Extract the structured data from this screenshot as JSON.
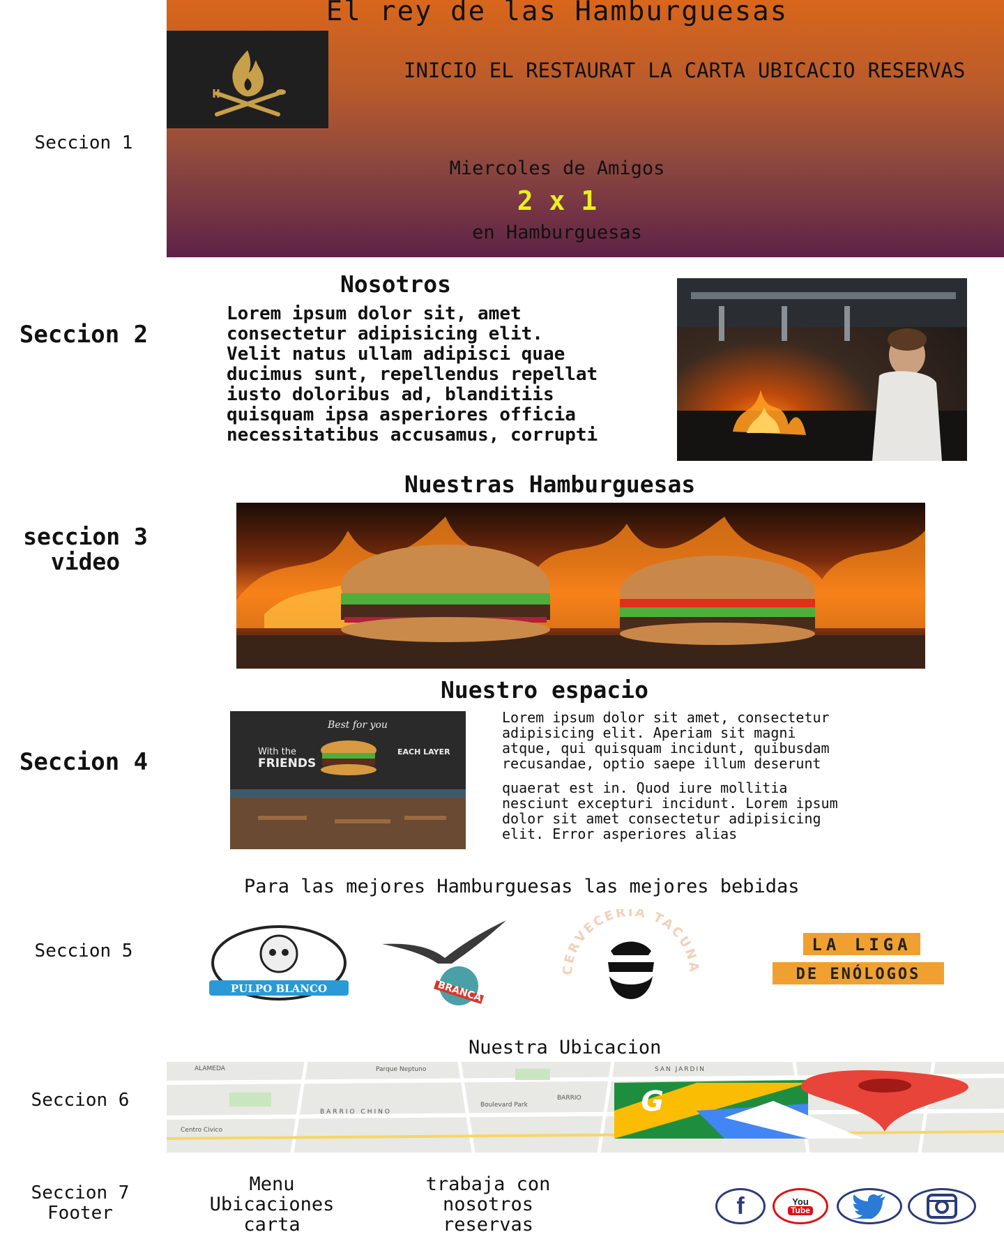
{
  "header": {
    "title": "El rey de las Hamburguesas",
    "nav": [
      "INICIO",
      "EL RESTAURAT",
      "LA CARTA",
      "UBICACIO",
      "RESERVAS"
    ],
    "promo": {
      "line1": "Miercoles de Amigos",
      "big": "2 x 1",
      "line3": "en Hamburguesas"
    }
  },
  "labels": {
    "s1": "Seccion 1",
    "s2": "Seccion 2",
    "s3_line1": "seccion 3",
    "s3_line2": "video",
    "s4": "Seccion 4",
    "s5": "Seccion 5",
    "s6": "Seccion 6",
    "s7_line1": "Seccion 7",
    "s7_line2": "Footer"
  },
  "about": {
    "title": "Nosotros",
    "text": "Lorem ipsum dolor sit, amet\nconsectetur adipisicing elit.\nVelit natus ullam adipisci quae\nducimus sunt, repellendus repellat\niusto doloribus ad, blanditiis\nquisquam ipsa asperiores officia\nnecessitatibus accusamus, corrupti"
  },
  "burgers": {
    "title": "Nuestras Hamburguesas"
  },
  "space": {
    "title": "Nuestro espacio",
    "text1": "Lorem ipsum dolor sit amet, consectetur\nadipisicing elit. Aperiam sit magni\natque, qui quisquam incidunt, quibusdam\nrecusandae, optio saepe illum deserunt",
    "text2": "quaerat est in.  Quod iure mollitia\nnesciunt excepturi incidunt. Lorem ipsum\ndolor sit amet consectetur adipisicing\nelit. Error asperiores alias",
    "sign": {
      "best": "Best for you",
      "with": "With the",
      "friends": "FRIENDS",
      "each": "EACH LAYER"
    }
  },
  "drinks": {
    "title": "Para las mejores Hamburguesas las mejores bebidas",
    "brands": {
      "pulpo": "PULPO BLANCO",
      "branca": "BRANCA",
      "cerveceria": "CERVECERÍA TACUNA",
      "liga_line1": "LA LIGA",
      "liga_line2": "DE ENÓLOGOS"
    }
  },
  "location": {
    "title": "Nuestra Ubicacion",
    "map_labels": [
      "Parque Neptuno",
      "BARRIO CHINO",
      "Boulevard Park",
      "Centro Civico",
      "SAN JARDIN",
      "BARRIO",
      "ALAMEDA"
    ]
  },
  "footer": {
    "col1": [
      "Menu",
      "Ubicaciones",
      "carta"
    ],
    "col2": [
      "trabaja con",
      "nosotros",
      "reservas"
    ],
    "social": [
      "facebook",
      "youtube",
      "twitter",
      "instagram"
    ],
    "youtube_you": "You",
    "youtube_tube": "Tube"
  },
  "colors": {
    "hero_top": "#d9661b",
    "hero_bottom": "#5e2248",
    "promo_accent": "#e8f020",
    "logo_bg": "#1f1f1f",
    "logo_gold": "#c8a04a",
    "social_blue": "#2b3b7a",
    "youtube_red": "#d11"
  },
  "icons": [
    "flame-fork-logo-icon",
    "facebook-icon",
    "youtube-icon",
    "twitter-icon",
    "instagram-icon",
    "map-pin-icon",
    "google-maps-icon"
  ]
}
